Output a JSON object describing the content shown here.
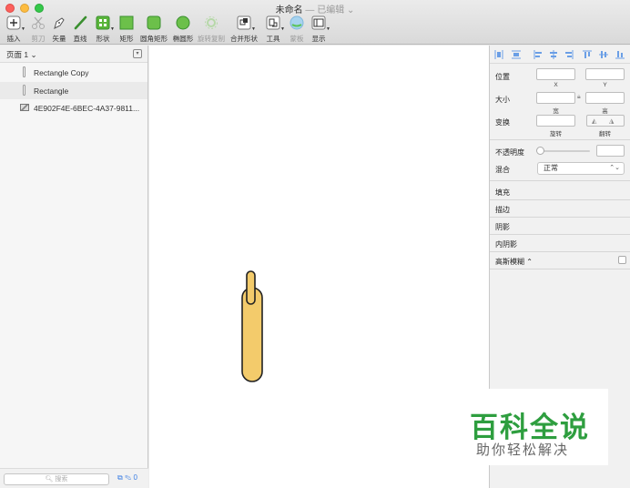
{
  "window": {
    "title": "未命名",
    "status": "— 已编辑 ⌄"
  },
  "toolbar": {
    "items": [
      {
        "label": "插入",
        "icon": "plus-icon"
      },
      {
        "label": "剪刀",
        "icon": "scissors-icon"
      },
      {
        "label": "矢量",
        "icon": "pen-icon"
      },
      {
        "label": "直线",
        "icon": "line-icon"
      },
      {
        "label": "形状",
        "icon": "shapes-icon"
      },
      {
        "label": "矩形",
        "icon": "rectangle-icon"
      },
      {
        "label": "圆角矩形",
        "icon": "rounded-rectangle-icon"
      },
      {
        "label": "椭圆形",
        "icon": "oval-icon"
      },
      {
        "label": "旋转复制",
        "icon": "rotate-copies-icon"
      },
      {
        "label": "合并形状",
        "icon": "combine-shapes-icon"
      },
      {
        "label": "工具",
        "icon": "tools-icon"
      },
      {
        "label": "蒙板",
        "icon": "mask-icon"
      },
      {
        "label": "显示",
        "icon": "view-icon"
      }
    ]
  },
  "sidebar": {
    "page_selector": "页面 1 ⌄",
    "layers": [
      {
        "name": "Rectangle Copy",
        "icon": "rectangle-layer-icon"
      },
      {
        "name": "Rectangle",
        "icon": "rectangle-layer-icon"
      },
      {
        "name": "4E902F4E-6BEC-4A37-9811...",
        "icon": "bitmap-layer-icon"
      }
    ],
    "search_placeholder": "搜索",
    "footer_count": "0"
  },
  "inspector": {
    "position_label": "位置",
    "x_label": "X",
    "y_label": "Y",
    "size_label": "大小",
    "width_label": "宽",
    "height_label": "高",
    "transform_label": "变换",
    "rotate_label": "旋转",
    "flip_label": "翻转",
    "opacity_label": "不透明度",
    "blend_label": "混合",
    "blend_value": "正常",
    "sections": [
      "填充",
      "描边",
      "阴影",
      "内阴影"
    ],
    "blur_label": "高斯模糊 ⌃",
    "blur_enabled": false
  },
  "canvas": {
    "shape_fill": "#f3cb6b",
    "shape_stroke": "#222222"
  },
  "watermark": {
    "title": "百科全说",
    "subtitle": "助你轻松解决"
  },
  "colors": {
    "accent": "#3b7ee4",
    "watermark_green": "#2e9e3f"
  }
}
